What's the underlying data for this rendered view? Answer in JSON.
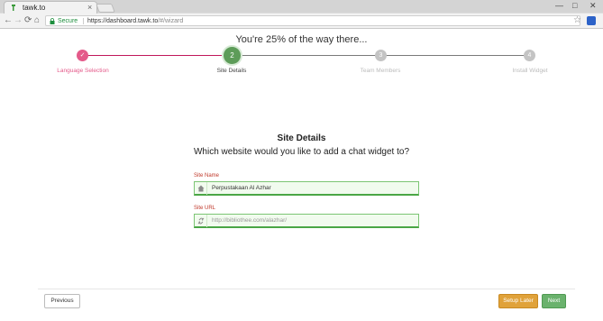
{
  "browser": {
    "tab_title": "tawk.to",
    "tab_close": "×",
    "minimize": "—",
    "maximize": "□",
    "close_window": "✕",
    "secure_label": "Secure",
    "url_host": "https://dashboard.tawk.to",
    "url_path": "/#/wizard",
    "back": "←",
    "forward": "→",
    "reload": "⟳",
    "home": "⌂",
    "star": "☆"
  },
  "wizard": {
    "progress_text": "You're 25% of the way there...",
    "progress_percent": 25,
    "steps": [
      {
        "number": "✓",
        "label": "Language Selection",
        "state": "done",
        "color": "#e45a8a"
      },
      {
        "number": "2",
        "label": "Site Details",
        "state": "active",
        "color": "#5d9c59"
      },
      {
        "number": "3",
        "label": "Team Members",
        "state": "pending",
        "color": "#c4c4c4"
      },
      {
        "number": "4",
        "label": "Install Widget",
        "state": "pending",
        "color": "#c4c4c4"
      }
    ],
    "heading": "Site Details",
    "subheading": "Which website would you like to add a chat widget to?",
    "site_name_label": "Site Name",
    "site_name_value": "Perpustakaan Al Azhar",
    "site_url_label": "Site URL",
    "site_url_value": "http://bibliothee.com/alazhar/",
    "previous_label": "Previous",
    "setup_later_label": "Setup Later",
    "next_label": "Next"
  }
}
